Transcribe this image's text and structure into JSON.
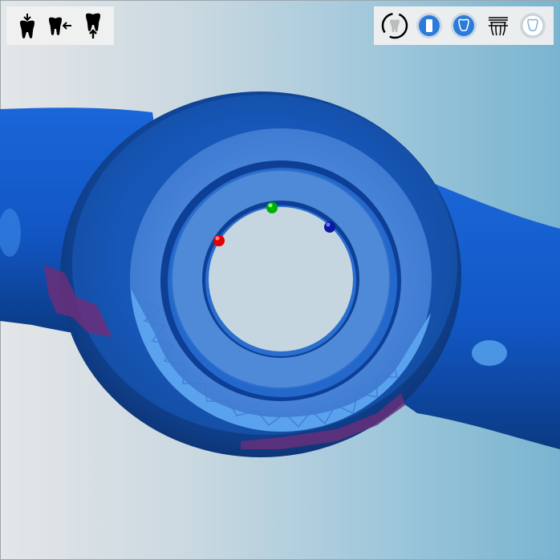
{
  "viewport": {
    "background_left": "#e4e6e8",
    "background_right": "#79b4d0"
  },
  "model": {
    "bar_color": "#1560d4",
    "bar_shadow": "#0a3a82",
    "ring_outer_color": "#4a86d8",
    "ring_inner_color": "#4f8ad8",
    "facet_color": "#5aa2ee",
    "contact_color": "#6b2e7a",
    "markers": [
      {
        "color": "#e00000",
        "name": "red-marker"
      },
      {
        "color": "#00b000",
        "name": "green-marker"
      },
      {
        "color": "#0a1aa0",
        "name": "blue-marker"
      }
    ]
  },
  "toolbar_left": {
    "tools": [
      {
        "icon": "tooth-insert-top-icon"
      },
      {
        "icon": "tooth-insert-side-icon"
      },
      {
        "icon": "tooth-insert-bottom-icon"
      }
    ]
  },
  "toolbar_right": {
    "tools": [
      {
        "icon": "tooth-rotate-view-icon"
      },
      {
        "icon": "tooth-front-view-icon"
      },
      {
        "icon": "tooth-top-view-icon"
      },
      {
        "icon": "bridge-view-icon"
      },
      {
        "icon": "tooth-transparent-icon"
      }
    ],
    "accent": "#2b7bd8"
  }
}
